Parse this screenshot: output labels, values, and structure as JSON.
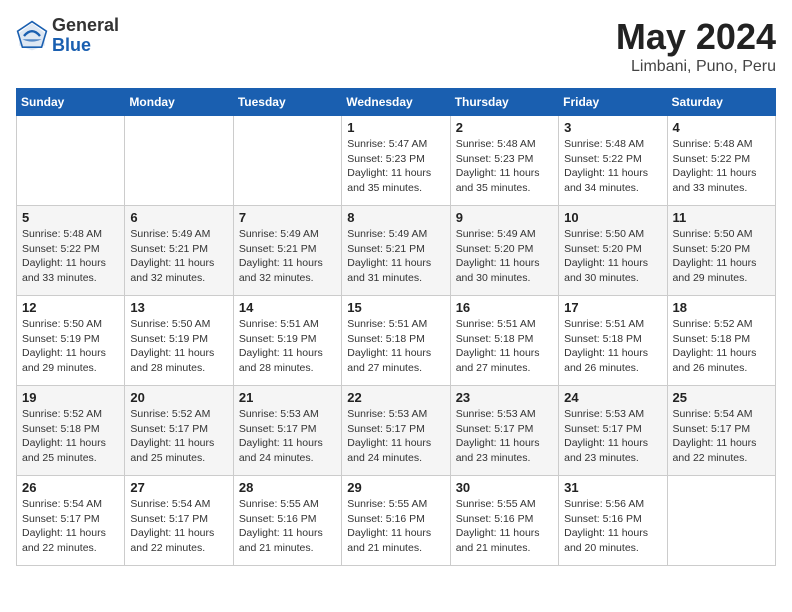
{
  "header": {
    "logo_general": "General",
    "logo_blue": "Blue",
    "title": "May 2024",
    "subtitle": "Limbani, Puno, Peru"
  },
  "days_of_week": [
    "Sunday",
    "Monday",
    "Tuesday",
    "Wednesday",
    "Thursday",
    "Friday",
    "Saturday"
  ],
  "weeks": [
    [
      {
        "day": null,
        "info": null
      },
      {
        "day": null,
        "info": null
      },
      {
        "day": null,
        "info": null
      },
      {
        "day": "1",
        "info": "Sunrise: 5:47 AM\nSunset: 5:23 PM\nDaylight: 11 hours and 35 minutes."
      },
      {
        "day": "2",
        "info": "Sunrise: 5:48 AM\nSunset: 5:23 PM\nDaylight: 11 hours and 35 minutes."
      },
      {
        "day": "3",
        "info": "Sunrise: 5:48 AM\nSunset: 5:22 PM\nDaylight: 11 hours and 34 minutes."
      },
      {
        "day": "4",
        "info": "Sunrise: 5:48 AM\nSunset: 5:22 PM\nDaylight: 11 hours and 33 minutes."
      }
    ],
    [
      {
        "day": "5",
        "info": "Sunrise: 5:48 AM\nSunset: 5:22 PM\nDaylight: 11 hours and 33 minutes."
      },
      {
        "day": "6",
        "info": "Sunrise: 5:49 AM\nSunset: 5:21 PM\nDaylight: 11 hours and 32 minutes."
      },
      {
        "day": "7",
        "info": "Sunrise: 5:49 AM\nSunset: 5:21 PM\nDaylight: 11 hours and 32 minutes."
      },
      {
        "day": "8",
        "info": "Sunrise: 5:49 AM\nSunset: 5:21 PM\nDaylight: 11 hours and 31 minutes."
      },
      {
        "day": "9",
        "info": "Sunrise: 5:49 AM\nSunset: 5:20 PM\nDaylight: 11 hours and 30 minutes."
      },
      {
        "day": "10",
        "info": "Sunrise: 5:50 AM\nSunset: 5:20 PM\nDaylight: 11 hours and 30 minutes."
      },
      {
        "day": "11",
        "info": "Sunrise: 5:50 AM\nSunset: 5:20 PM\nDaylight: 11 hours and 29 minutes."
      }
    ],
    [
      {
        "day": "12",
        "info": "Sunrise: 5:50 AM\nSunset: 5:19 PM\nDaylight: 11 hours and 29 minutes."
      },
      {
        "day": "13",
        "info": "Sunrise: 5:50 AM\nSunset: 5:19 PM\nDaylight: 11 hours and 28 minutes."
      },
      {
        "day": "14",
        "info": "Sunrise: 5:51 AM\nSunset: 5:19 PM\nDaylight: 11 hours and 28 minutes."
      },
      {
        "day": "15",
        "info": "Sunrise: 5:51 AM\nSunset: 5:18 PM\nDaylight: 11 hours and 27 minutes."
      },
      {
        "day": "16",
        "info": "Sunrise: 5:51 AM\nSunset: 5:18 PM\nDaylight: 11 hours and 27 minutes."
      },
      {
        "day": "17",
        "info": "Sunrise: 5:51 AM\nSunset: 5:18 PM\nDaylight: 11 hours and 26 minutes."
      },
      {
        "day": "18",
        "info": "Sunrise: 5:52 AM\nSunset: 5:18 PM\nDaylight: 11 hours and 26 minutes."
      }
    ],
    [
      {
        "day": "19",
        "info": "Sunrise: 5:52 AM\nSunset: 5:18 PM\nDaylight: 11 hours and 25 minutes."
      },
      {
        "day": "20",
        "info": "Sunrise: 5:52 AM\nSunset: 5:17 PM\nDaylight: 11 hours and 25 minutes."
      },
      {
        "day": "21",
        "info": "Sunrise: 5:53 AM\nSunset: 5:17 PM\nDaylight: 11 hours and 24 minutes."
      },
      {
        "day": "22",
        "info": "Sunrise: 5:53 AM\nSunset: 5:17 PM\nDaylight: 11 hours and 24 minutes."
      },
      {
        "day": "23",
        "info": "Sunrise: 5:53 AM\nSunset: 5:17 PM\nDaylight: 11 hours and 23 minutes."
      },
      {
        "day": "24",
        "info": "Sunrise: 5:53 AM\nSunset: 5:17 PM\nDaylight: 11 hours and 23 minutes."
      },
      {
        "day": "25",
        "info": "Sunrise: 5:54 AM\nSunset: 5:17 PM\nDaylight: 11 hours and 22 minutes."
      }
    ],
    [
      {
        "day": "26",
        "info": "Sunrise: 5:54 AM\nSunset: 5:17 PM\nDaylight: 11 hours and 22 minutes."
      },
      {
        "day": "27",
        "info": "Sunrise: 5:54 AM\nSunset: 5:17 PM\nDaylight: 11 hours and 22 minutes."
      },
      {
        "day": "28",
        "info": "Sunrise: 5:55 AM\nSunset: 5:16 PM\nDaylight: 11 hours and 21 minutes."
      },
      {
        "day": "29",
        "info": "Sunrise: 5:55 AM\nSunset: 5:16 PM\nDaylight: 11 hours and 21 minutes."
      },
      {
        "day": "30",
        "info": "Sunrise: 5:55 AM\nSunset: 5:16 PM\nDaylight: 11 hours and 21 minutes."
      },
      {
        "day": "31",
        "info": "Sunrise: 5:56 AM\nSunset: 5:16 PM\nDaylight: 11 hours and 20 minutes."
      },
      {
        "day": null,
        "info": null
      }
    ]
  ]
}
